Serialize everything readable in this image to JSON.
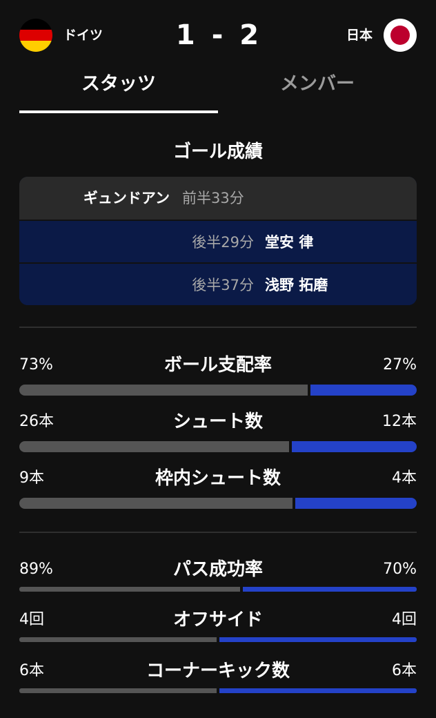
{
  "match": {
    "home_team": "ドイツ",
    "away_team": "日本",
    "home_score": "1",
    "separator": "-",
    "away_score": "2",
    "home_flag_icon": "germany-flag-icon",
    "away_flag_icon": "japan-flag-icon"
  },
  "tabs": {
    "stats": "スタッツ",
    "members": "メンバー",
    "active": "stats"
  },
  "goals": {
    "title": "ゴール成績",
    "items": [
      {
        "side": "home",
        "player": "ギュンドアン",
        "time": "前半33分"
      },
      {
        "side": "away",
        "player": "堂安 律",
        "time": "後半29分"
      },
      {
        "side": "away",
        "player": "浅野 拓磨",
        "time": "後半37分"
      }
    ]
  },
  "stats": [
    {
      "label": "ボール支配率",
      "home": "73%",
      "away": "27%",
      "home_share": 0.73
    },
    {
      "label": "シュート数",
      "home": "26本",
      "away": "12本",
      "home_share": 0.684
    },
    {
      "label": "枠内シュート数",
      "home": "9本",
      "away": "4本",
      "home_share": 0.692
    },
    {
      "label": "パス成功率",
      "home": "89%",
      "away": "70%",
      "home_share": 0.56
    },
    {
      "label": "オフサイド",
      "home": "4回",
      "away": "4回",
      "home_share": 0.5
    },
    {
      "label": "コーナーキック数",
      "home": "6本",
      "away": "6本",
      "home_share": 0.5
    }
  ],
  "colors": {
    "background": "#111111",
    "home_bar": "#555555",
    "away_bar": "#2442c8",
    "away_goal_row": "#0b1a47",
    "home_goal_row": "#2a2a2a"
  }
}
